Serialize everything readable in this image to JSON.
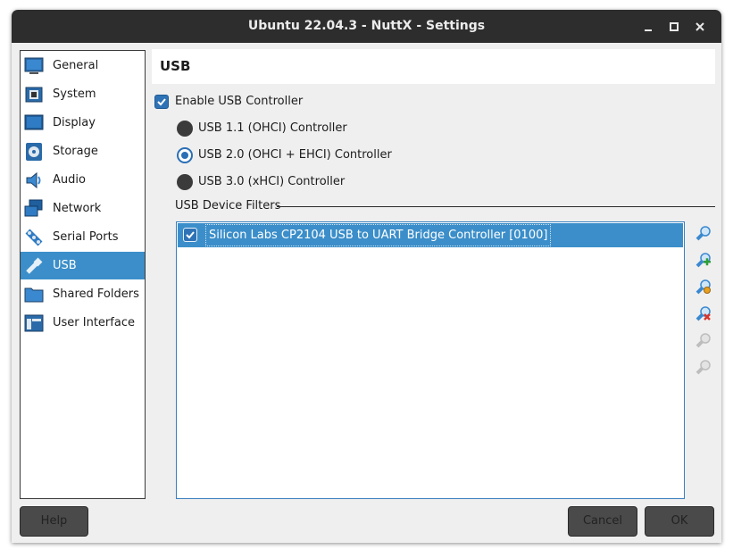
{
  "window": {
    "title": "Ubuntu 22.04.3 - NuttX - Settings"
  },
  "titlebar_controls": {
    "minimize": "▁",
    "maximize": "□",
    "close": "✕"
  },
  "sidebar": {
    "items": [
      {
        "label": "General",
        "icon": "general-icon",
        "selected": false
      },
      {
        "label": "System",
        "icon": "system-icon",
        "selected": false
      },
      {
        "label": "Display",
        "icon": "display-icon",
        "selected": false
      },
      {
        "label": "Storage",
        "icon": "storage-icon",
        "selected": false
      },
      {
        "label": "Audio",
        "icon": "audio-icon",
        "selected": false
      },
      {
        "label": "Network",
        "icon": "network-icon",
        "selected": false
      },
      {
        "label": "Serial Ports",
        "icon": "serial-ports-icon",
        "selected": false
      },
      {
        "label": "USB",
        "icon": "usb-icon",
        "selected": true
      },
      {
        "label": "Shared Folders",
        "icon": "shared-folders-icon",
        "selected": false
      },
      {
        "label": "User Interface",
        "icon": "user-interface-icon",
        "selected": false
      }
    ]
  },
  "page": {
    "title": "USB"
  },
  "usb": {
    "enable_label": "Enable USB Controller",
    "enabled": true,
    "controllers": [
      {
        "label": "USB 1.1 (OHCI) Controller",
        "checked": false
      },
      {
        "label": "USB 2.0 (OHCI + EHCI) Controller",
        "checked": true
      },
      {
        "label": "USB 3.0 (xHCI) Controller",
        "checked": false
      }
    ],
    "filters_label": "USB Device Filters",
    "filters": [
      {
        "label": "Silicon Labs CP2104 USB to UART Bridge Controller [0100]",
        "checked": true
      }
    ],
    "filter_tools": [
      {
        "icon": "add-empty-filter-icon",
        "enabled": true
      },
      {
        "icon": "add-device-filter-icon",
        "enabled": true
      },
      {
        "icon": "edit-filter-icon",
        "enabled": true
      },
      {
        "icon": "remove-filter-icon",
        "enabled": true
      },
      {
        "icon": "move-filter-up-icon",
        "enabled": false
      },
      {
        "icon": "move-filter-down-icon",
        "enabled": false
      }
    ]
  },
  "footer": {
    "help_label": "Help",
    "cancel_label": "Cancel",
    "ok_label": "OK"
  },
  "colors": {
    "accent": "#3b8ec9",
    "titlebar": "#2d2d2d",
    "background": "#efefef"
  }
}
